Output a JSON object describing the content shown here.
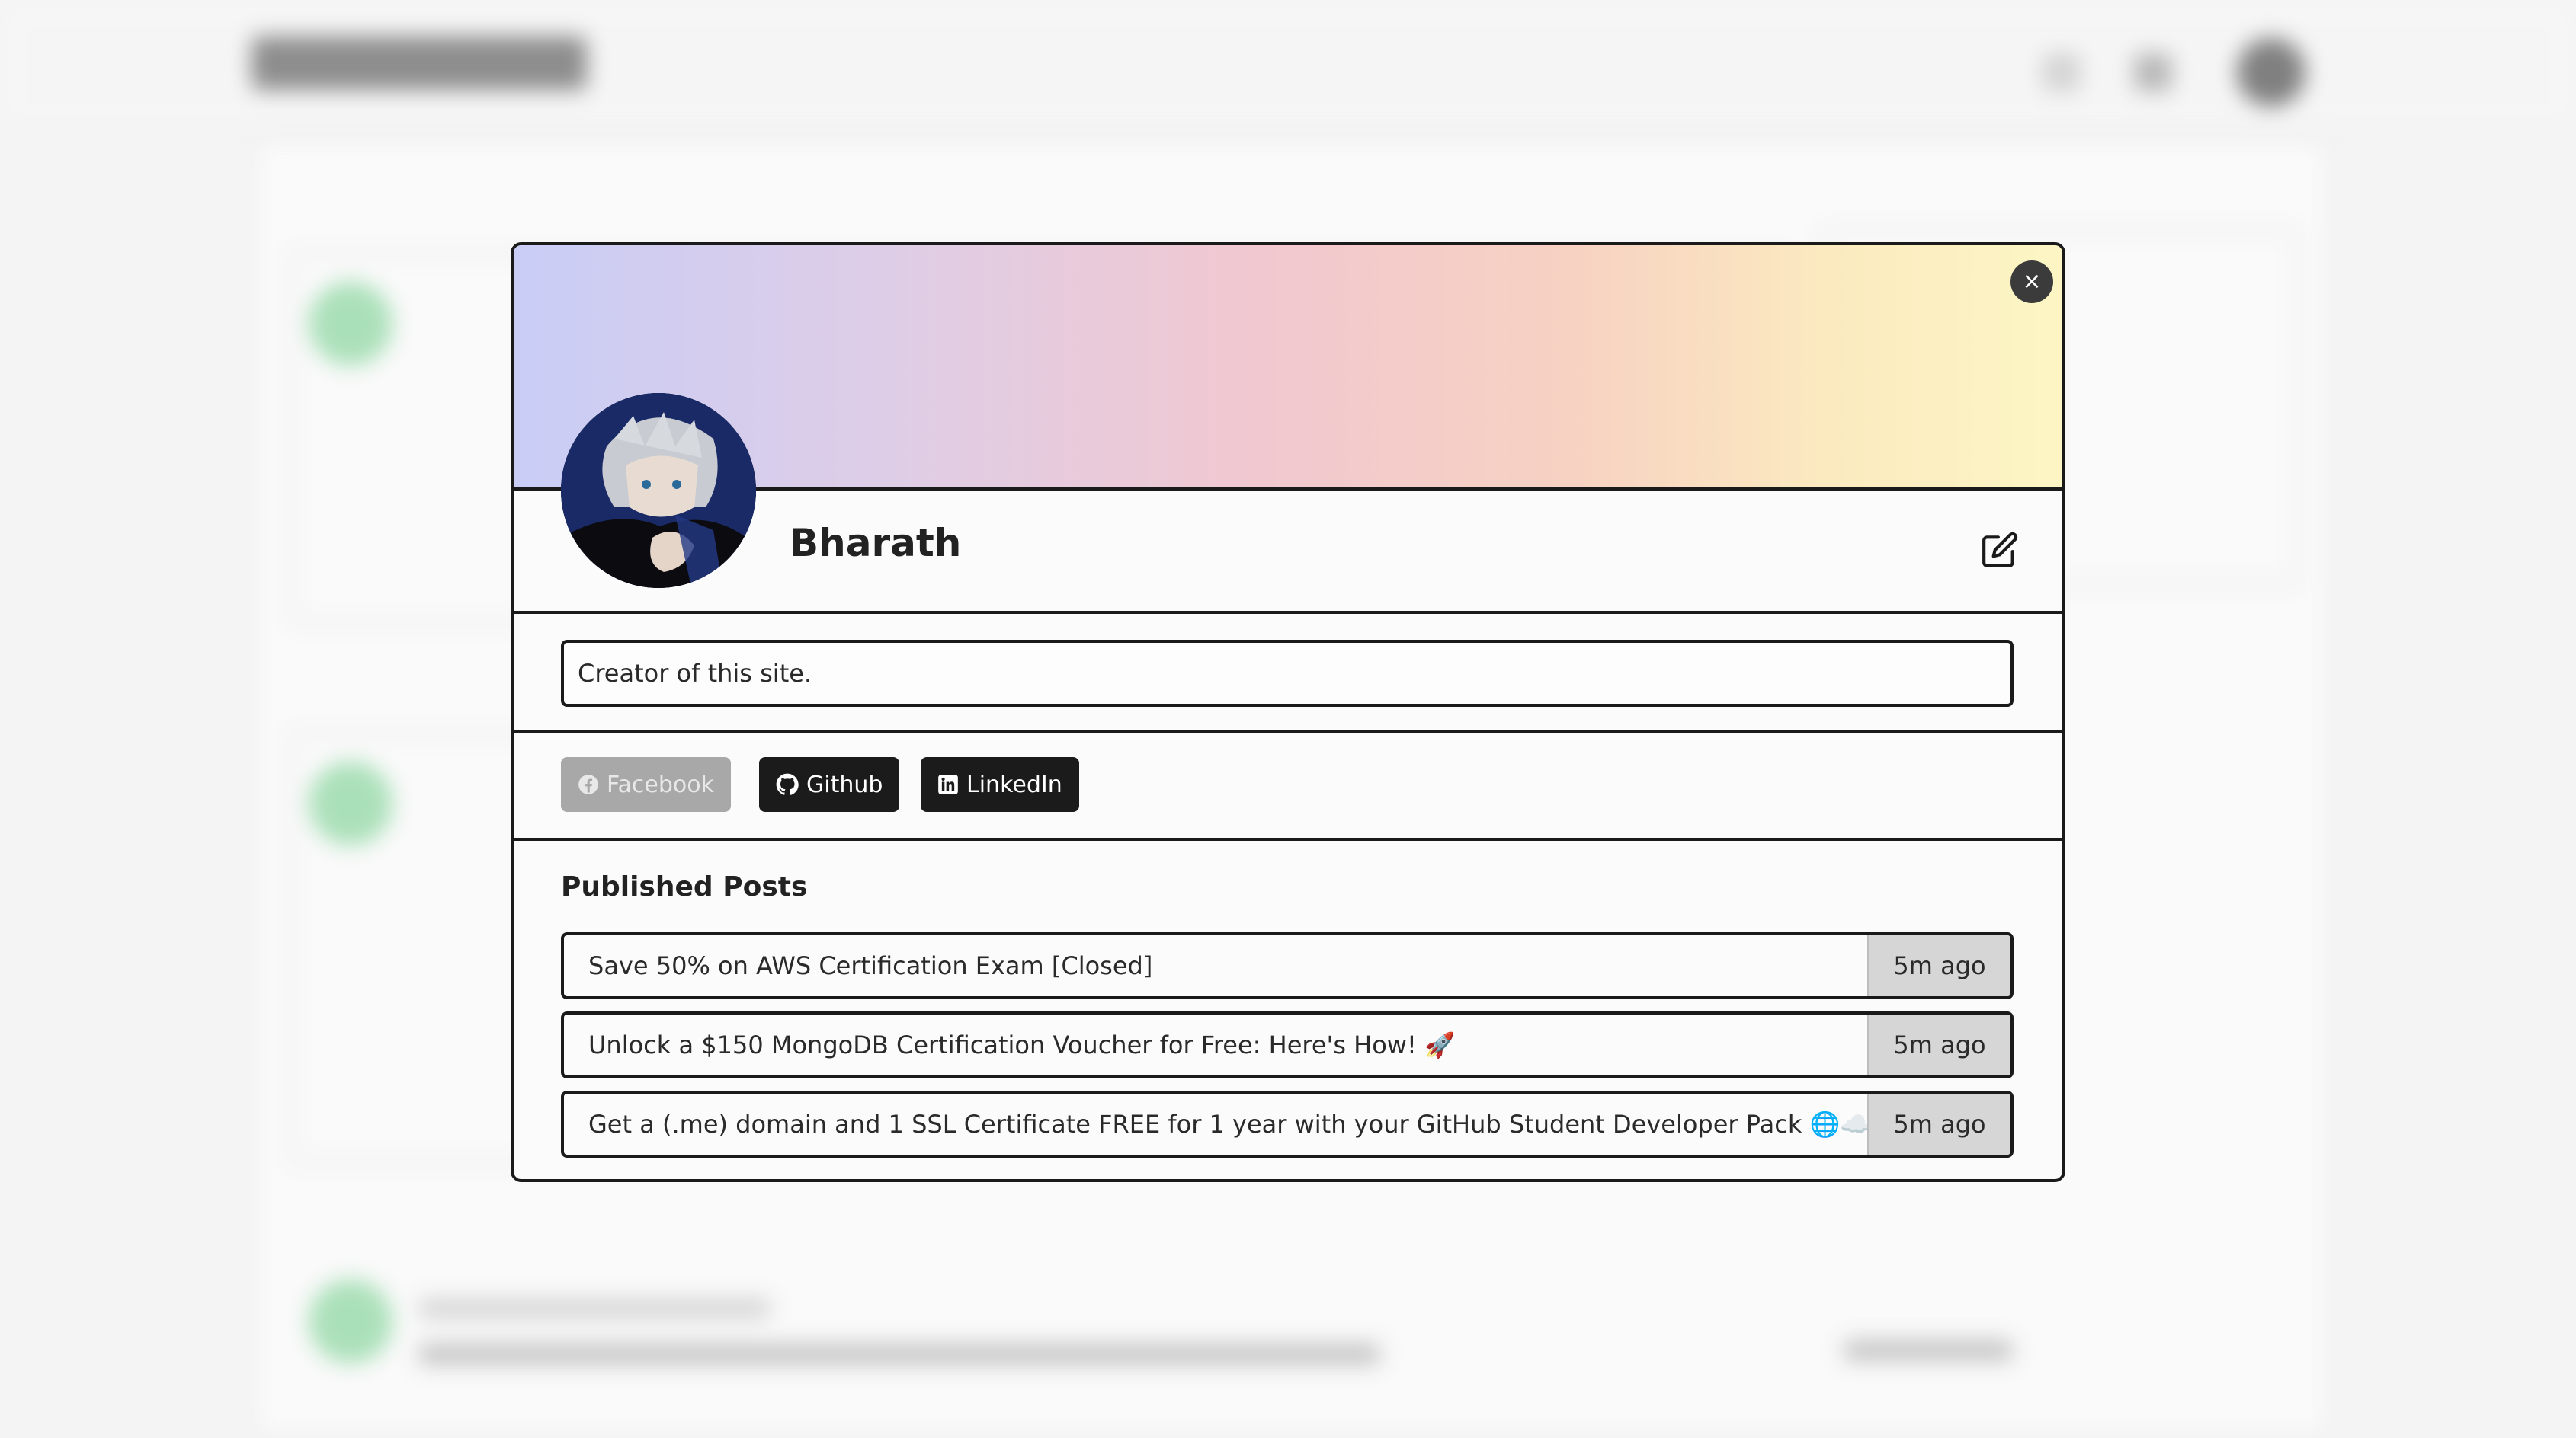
{
  "modal": {
    "close_label": "×",
    "profile": {
      "name": "Bharath",
      "bio_value": "Creator of this site."
    },
    "social_links": [
      {
        "label": "Facebook",
        "icon": "facebook-icon",
        "state": "disabled"
      },
      {
        "label": "Github",
        "icon": "github-icon",
        "state": "active"
      },
      {
        "label": "LinkedIn",
        "icon": "linkedin-icon",
        "state": "active"
      }
    ],
    "posts_section_title": "Published Posts",
    "posts": [
      {
        "title": "Save 50% on AWS Certification Exam [Closed]",
        "time": "5m ago"
      },
      {
        "title": "Unlock a $150 MongoDB Certification Voucher for Free: Here's How! 🚀",
        "time": "5m ago"
      },
      {
        "title": "Get a (.me) domain and 1 SSL Certificate FREE for 1 year with your GitHub Student Developer Pack 🌐☁️",
        "time": "5m ago"
      }
    ]
  },
  "colors": {
    "banner_gradient": [
      "#c9cdf6",
      "#f1c8d0",
      "#fdf6c4"
    ],
    "dark_button": "#1b1b1b",
    "disabled_button": "#a8a8a8",
    "time_badge": "#d6d6d6"
  }
}
